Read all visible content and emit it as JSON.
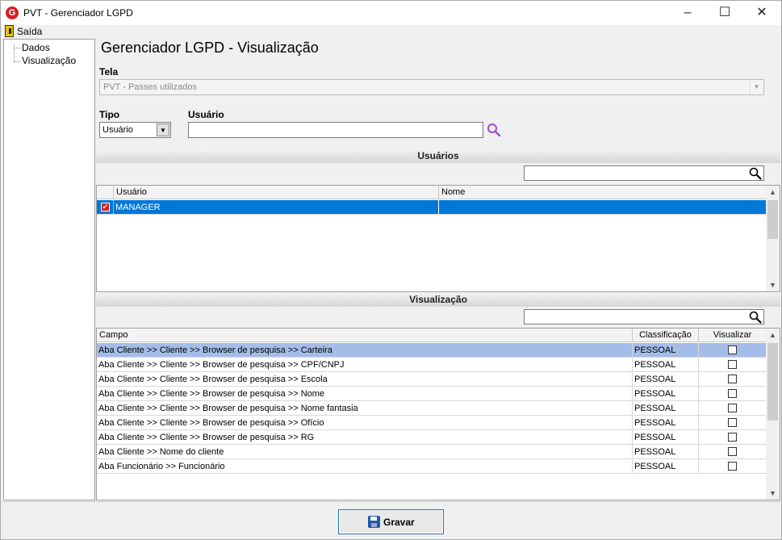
{
  "window": {
    "app_icon": "G",
    "title": "PVT - Gerenciador LGPD",
    "controls": {
      "minimize": "–",
      "maximize": "☐",
      "close": "✕"
    }
  },
  "menu": {
    "exit_label": "Saída",
    "exit_icon": "exit-door-icon"
  },
  "tree": {
    "items": [
      {
        "label": "Dados"
      },
      {
        "label": "Visualização"
      }
    ]
  },
  "page": {
    "heading": "Gerenciador LGPD - Visualização"
  },
  "form": {
    "tela_label": "Tela",
    "tela_value": "PVT - Passes utilizados",
    "tipo_label": "Tipo",
    "tipo_value": "Usuário",
    "usuario_label": "Usuário",
    "usuario_value": ""
  },
  "users_section": {
    "header": "Usuários",
    "search_value": "",
    "columns": [
      "Usuário",
      "Nome"
    ],
    "rows": [
      {
        "checked": true,
        "usuario": "MANAGER",
        "nome": ""
      }
    ]
  },
  "view_section": {
    "header": "Visualização",
    "search_value": "",
    "columns": [
      "Campo",
      "Classificação",
      "Visualizar"
    ],
    "rows": [
      {
        "campo": "Aba Cliente >> Cliente >> Browser de pesquisa >> Carteira",
        "classificacao": "PESSOAL",
        "visualizar": false
      },
      {
        "campo": "Aba Cliente >> Cliente >> Browser de pesquisa >> CPF/CNPJ",
        "classificacao": "PESSOAL",
        "visualizar": false
      },
      {
        "campo": "Aba Cliente >> Cliente >> Browser de pesquisa >> Escola",
        "classificacao": "PESSOAL",
        "visualizar": false
      },
      {
        "campo": "Aba Cliente >> Cliente >> Browser de pesquisa >> Nome",
        "classificacao": "PESSOAL",
        "visualizar": false
      },
      {
        "campo": "Aba Cliente >> Cliente >> Browser de pesquisa >> Nome fantasia",
        "classificacao": "PESSOAL",
        "visualizar": false
      },
      {
        "campo": "Aba Cliente >> Cliente >> Browser de pesquisa >> Ofício",
        "classificacao": "PESSOAL",
        "visualizar": false
      },
      {
        "campo": "Aba Cliente >> Cliente >> Browser de pesquisa >> RG",
        "classificacao": "PESSOAL",
        "visualizar": false
      },
      {
        "campo": "Aba Cliente >> Nome do cliente",
        "classificacao": "PESSOAL",
        "visualizar": false
      },
      {
        "campo": "Aba Funcionário >> Funcionário",
        "classificacao": "PESSOAL",
        "visualizar": false
      }
    ]
  },
  "actions": {
    "save_label": "Gravar"
  },
  "colors": {
    "selected_row": "#0078d7",
    "highlight_row": "#a4bce8",
    "checked_red": "#d02020",
    "search_purple": "#a24bd0"
  }
}
